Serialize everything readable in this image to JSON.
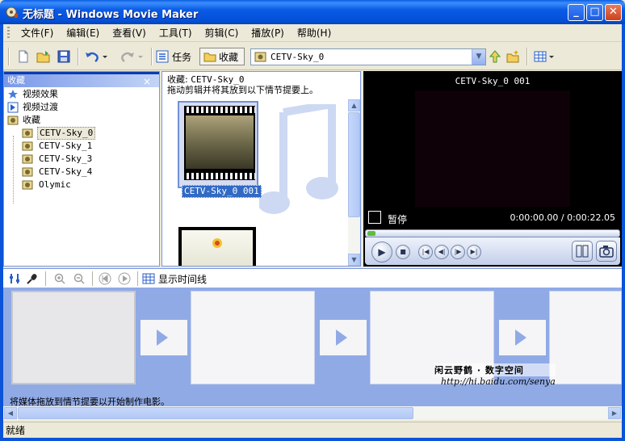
{
  "window": {
    "title": "无标题 - Windows Movie Maker",
    "minimize_glyph": "_",
    "maximize_glyph": "□",
    "close_glyph": "✕"
  },
  "menu": [
    "文件(F)",
    "编辑(E)",
    "查看(V)",
    "工具(T)",
    "剪辑(C)",
    "播放(P)",
    "帮助(H)"
  ],
  "toolbar": {
    "tasks_label": "任务",
    "collections_label": "收藏",
    "collection_combo_value": "CETV-Sky_0"
  },
  "collections_pane": {
    "header": "收藏",
    "close_glyph": "×",
    "tree": [
      {
        "label": "视频效果",
        "level": 0,
        "icon": "star-icon"
      },
      {
        "label": "视频过渡",
        "level": 0,
        "icon": "transition-icon"
      },
      {
        "label": "收藏",
        "level": 0,
        "icon": "collection-folder-icon"
      },
      {
        "label": "CETV-Sky_0",
        "level": 1,
        "icon": "film-reel-icon",
        "selected": true
      },
      {
        "label": "CETV-Sky_1",
        "level": 1,
        "icon": "film-reel-icon"
      },
      {
        "label": "CETV-Sky_3",
        "level": 1,
        "icon": "film-reel-icon"
      },
      {
        "label": "CETV-Sky_4",
        "level": 1,
        "icon": "film-reel-icon"
      },
      {
        "label": "Olymic",
        "level": 1,
        "icon": "film-reel-icon"
      }
    ]
  },
  "contents_pane": {
    "heading_prefix": "收藏:",
    "heading_name": "CETV-Sky_0",
    "instruction": "拖动剪辑并将其放到以下情节提要上。",
    "clips": [
      {
        "label": "CETV-Sky_0 001",
        "selected": true
      }
    ]
  },
  "monitor": {
    "clip_title": "CETV-Sky_0 001",
    "state": "暂停",
    "time": "0:00:00.00 / 0:00:22.05",
    "progress_fraction": 0.0
  },
  "storyboard": {
    "show_timeline_label": "显示时间线",
    "hint": "将媒体拖放到情节提要以开始制作电影。",
    "watermark_line1": "闲云野鹤 · 数字空间",
    "watermark_line2": "http://hi.baidu.com/senya"
  },
  "statusbar": {
    "text": "就绪"
  },
  "colors": {
    "title_bar": "#0b5be5",
    "storyboard_bg": "#90aae6",
    "selection": "#316ac5"
  }
}
